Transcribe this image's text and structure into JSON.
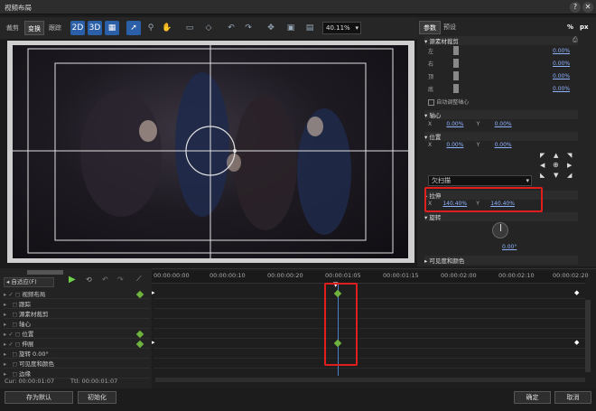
{
  "window": {
    "title": "视频布局"
  },
  "toolbar": {
    "tabs": [
      "裁剪",
      "变换",
      "跟踪"
    ],
    "zoom_value": "40.11%",
    "icons": [
      "2d-icon",
      "3d-icon",
      "grid-icon",
      "pointer-icon",
      "zoom-icon",
      "hand-icon",
      "rect-icon",
      "diamond-icon",
      "undo-icon",
      "redo-icon",
      "move-icon",
      "mask-icon",
      "transform-icon"
    ]
  },
  "panel": {
    "tabs": [
      "参数",
      "预设"
    ],
    "unit_percent": "%",
    "unit_px": "px",
    "crop": {
      "title": "源素材裁剪",
      "rows": [
        {
          "label": "左",
          "value": "0.00%"
        },
        {
          "label": "右",
          "value": "0.00%"
        },
        {
          "label": "顶",
          "value": "0.00%"
        },
        {
          "label": "底",
          "value": "0.00%"
        }
      ],
      "auto_center_label": "自动调整轴心"
    },
    "anchor": {
      "title": "轴心",
      "x_label": "X",
      "x_value": "0.00%",
      "y_label": "Y",
      "y_value": "0.00%"
    },
    "position": {
      "title": "位置",
      "x_label": "X",
      "x_value": "0.00%",
      "y_label": "Y",
      "y_value": "0.00%"
    },
    "scan_select": "欠扫描",
    "stretch": {
      "title": "拉伸",
      "x_label": "X",
      "x_value": "140.40%",
      "y_label": "Y",
      "y_value": "140.40%"
    },
    "rotation": {
      "title": "旋转",
      "value": "0.00°"
    },
    "visibility": {
      "title": "可见度和颜色"
    }
  },
  "timeline": {
    "fit_label": "自适应(F)",
    "ruler_labels": [
      "00:00:00:00",
      "00:00:00:10",
      "00:00:00:20",
      "00:00:01:05",
      "00:00:01:15",
      "00:00:02:00",
      "00:00:02:10",
      "00:00:02:20"
    ],
    "tracks": [
      {
        "label": "视频布局",
        "check": true,
        "expand": true
      },
      {
        "label": "跟踪",
        "check": false,
        "expand": false
      },
      {
        "label": "源素材裁剪",
        "check": false,
        "expand": false
      },
      {
        "label": "轴心",
        "check": false,
        "expand": false
      },
      {
        "label": "位置",
        "check": true,
        "expand": false
      },
      {
        "label": "伸展",
        "check": true,
        "expand": true
      },
      {
        "label": "旋转 0.00°",
        "check": false,
        "expand": false
      },
      {
        "label": "可见度和颜色",
        "check": false,
        "expand": false
      },
      {
        "label": "边缘",
        "check": false,
        "expand": false
      }
    ],
    "cur_label": "Cur: 00:00:01:07",
    "ttl_label": "Ttl: 00:00:01:07"
  },
  "footer": {
    "save_default": "存为默认",
    "initialize": "初始化",
    "ok": "确定",
    "cancel": "取消"
  },
  "colors": {
    "accent": "#2b5fa8",
    "keyframe": "#6fb33e",
    "highlight": "#e01e1e",
    "value": "#8fb2ff"
  }
}
